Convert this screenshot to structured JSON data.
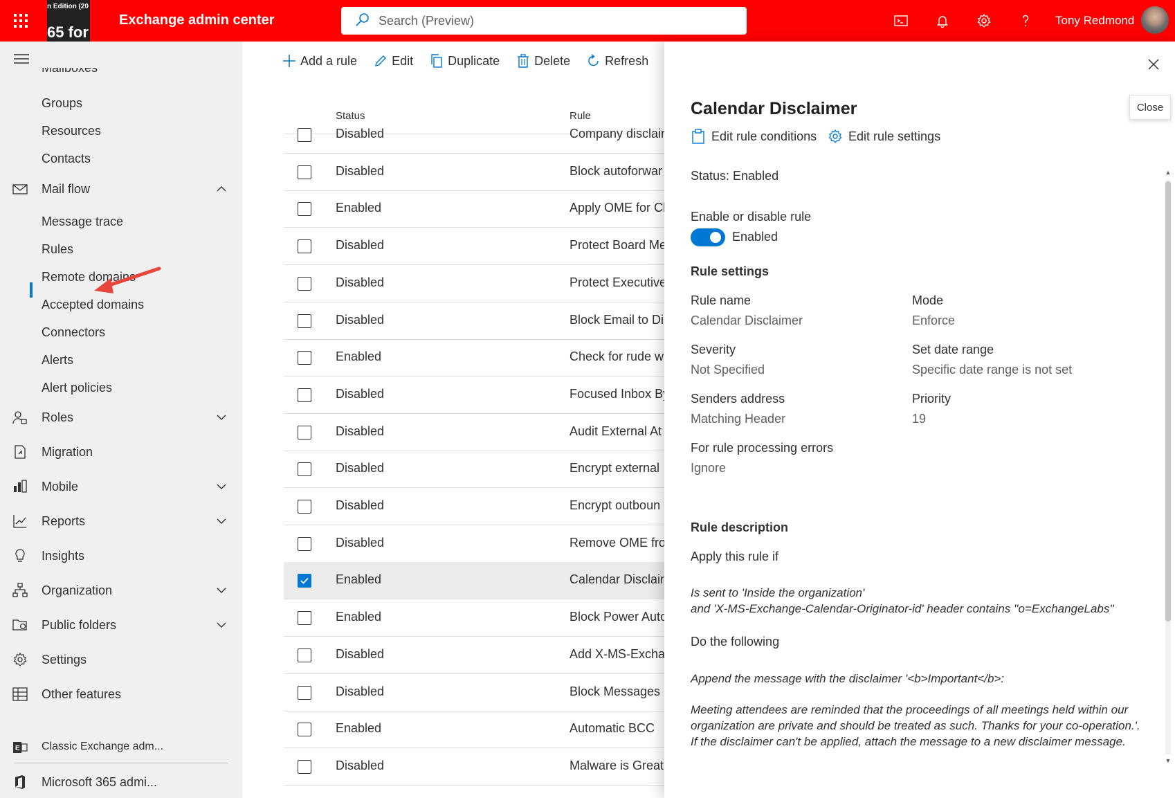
{
  "topbar": {
    "brand_line1": "n Edition (20",
    "brand_line2": "65 for",
    "app_title": "Exchange admin center",
    "search_placeholder": "Search (Preview)",
    "user_name": "Tony Redmond",
    "icons": [
      "waffle-icon",
      "terminal-icon",
      "bell-icon",
      "gear-icon",
      "help-icon"
    ]
  },
  "sidebar": {
    "cut_item": "Mailboxes",
    "recipients_sub": [
      "Groups",
      "Resources",
      "Contacts"
    ],
    "mail_flow": "Mail flow",
    "mail_flow_sub": [
      "Message trace",
      "Rules",
      "Remote domains",
      "Accepted domains",
      "Connectors",
      "Alerts",
      "Alert policies"
    ],
    "items": [
      {
        "label": "Roles",
        "icon": "roles-icon"
      },
      {
        "label": "Migration",
        "icon": "migration-icon"
      },
      {
        "label": "Mobile",
        "icon": "mobile-icon"
      },
      {
        "label": "Reports",
        "icon": "reports-icon"
      },
      {
        "label": "Insights",
        "icon": "insights-icon"
      },
      {
        "label": "Organization",
        "icon": "organization-icon"
      },
      {
        "label": "Public folders",
        "icon": "public-folders-icon"
      },
      {
        "label": "Settings",
        "icon": "settings-icon"
      },
      {
        "label": "Other features",
        "icon": "other-features-icon"
      }
    ],
    "footer": [
      {
        "label": "Classic Exchange adm...",
        "icon": "exchange-logo-icon"
      },
      {
        "label": "Microsoft 365 admi...",
        "icon": "office-logo-icon"
      }
    ],
    "active_color": "#0078d4"
  },
  "commands": {
    "add": "Add a rule",
    "edit": "Edit",
    "duplicate": "Duplicate",
    "delete": "Delete",
    "refresh": "Refresh"
  },
  "table": {
    "headers": {
      "status": "Status",
      "rule": "Rule"
    },
    "rows": [
      {
        "status": "Disabled",
        "rule": "Company disclair",
        "checked": false
      },
      {
        "status": "Disabled",
        "rule": "Block autoforwar",
        "checked": false
      },
      {
        "status": "Enabled",
        "rule": "Apply OME for Cl",
        "checked": false
      },
      {
        "status": "Disabled",
        "rule": "Protect Board Me",
        "checked": false
      },
      {
        "status": "Disabled",
        "rule": "Protect Executive",
        "checked": false
      },
      {
        "status": "Disabled",
        "rule": "Block Email to Di",
        "checked": false
      },
      {
        "status": "Enabled",
        "rule": "Check for rude w",
        "checked": false
      },
      {
        "status": "Disabled",
        "rule": "Focused Inbox By",
        "checked": false
      },
      {
        "status": "Disabled",
        "rule": "Audit External At",
        "checked": false
      },
      {
        "status": "Disabled",
        "rule": "Encrypt external",
        "checked": false
      },
      {
        "status": "Disabled",
        "rule": "Encrypt outboun",
        "checked": false
      },
      {
        "status": "Disabled",
        "rule": "Remove OME fro",
        "checked": false
      },
      {
        "status": "Enabled",
        "rule": "Calendar Disclain",
        "checked": true
      },
      {
        "status": "Enabled",
        "rule": "Block Power Auto",
        "checked": false
      },
      {
        "status": "Disabled",
        "rule": "Add X-MS-Exchar",
        "checked": false
      },
      {
        "status": "Disabled",
        "rule": "Block Messages C",
        "checked": false
      },
      {
        "status": "Enabled",
        "rule": "Automatic BCC",
        "checked": false
      },
      {
        "status": "Disabled",
        "rule": "Malware is Great",
        "checked": false
      }
    ]
  },
  "panel": {
    "close_tooltip": "Close",
    "title": "Calendar Disclaimer",
    "edit_conditions": "Edit rule conditions",
    "edit_settings": "Edit rule settings",
    "status": "Status: Enabled",
    "toggle_heading": "Enable or disable rule",
    "toggle_label": "Enabled",
    "toggle_on": true,
    "settings_heading": "Rule settings",
    "fields": {
      "rule_name_label": "Rule name",
      "rule_name": "Calendar Disclaimer",
      "mode_label": "Mode",
      "mode": "Enforce",
      "severity_label": "Severity",
      "severity": "Not Specified",
      "date_range_label": "Set date range",
      "date_range": "Specific date range is not set",
      "senders_label": "Senders address",
      "senders": "Matching Header",
      "priority_label": "Priority",
      "priority": "19",
      "errors_label": "For rule processing errors",
      "errors": "Ignore"
    },
    "description_heading": "Rule description",
    "apply_heading": "Apply this rule if",
    "condition_line1": "Is sent to 'Inside the organization'",
    "condition_line2": "and 'X-MS-Exchange-Calendar-Originator-id' header contains ''o=ExchangeLabs''",
    "do_heading": "Do the following",
    "action_line1": "Append the message with the disclaimer '<b>Important</b>:",
    "action_para": "Meeting attendees are reminded that the proceedings of all meetings held within our organization are private and should be treated as such. Thanks for your co-operation.'. If the disclaimer can't be applied, attach the message to a new disclaimer message."
  }
}
